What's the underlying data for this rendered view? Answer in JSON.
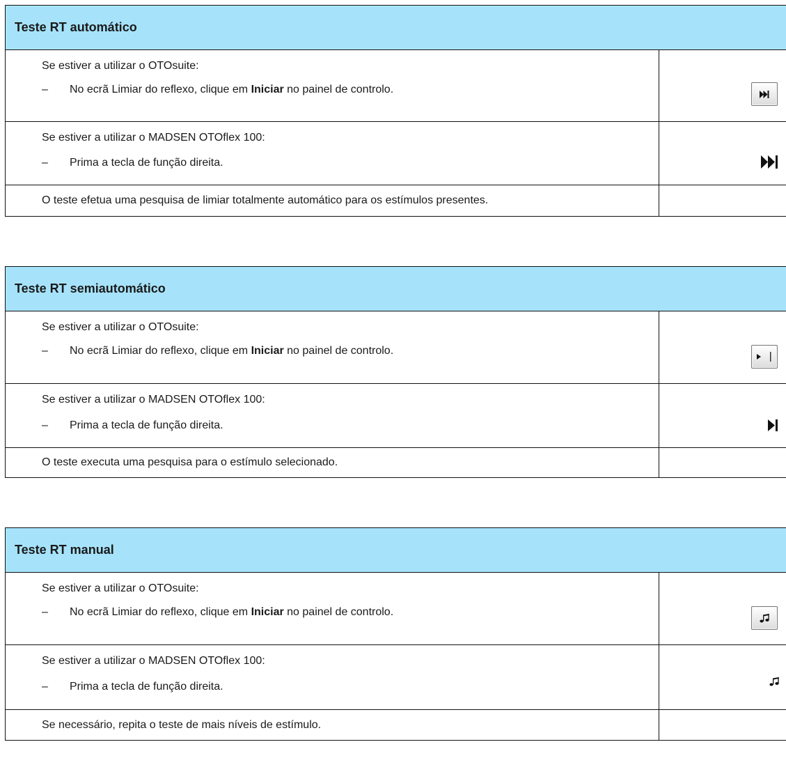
{
  "sections": [
    {
      "title": "Teste RT automático",
      "otosuite_intro": "Se estiver a utilizar o OTOsuite:",
      "otosuite_step_pre": "No ecrã Limiar do reflexo, clique em ",
      "otosuite_step_bold": "Iniciar",
      "otosuite_step_post": " no painel de controlo.",
      "otoflex_intro": "Se estiver a utilizar o MADSEN OTOflex 100:",
      "otoflex_step": "Prima a tecla de função direita.",
      "result": "O teste efetua uma pesquisa de limiar totalmente automático para os estímulos presentes.",
      "button_icon": "fast-forward-end-icon",
      "key_icon": "fast-forward-end-icon"
    },
    {
      "title": "Teste RT semiautomático",
      "otosuite_intro": "Se estiver a utilizar o OTOsuite:",
      "otosuite_step_pre": "No ecrã Limiar do reflexo, clique em ",
      "otosuite_step_bold": "Iniciar",
      "otosuite_step_post": " no painel de controlo.",
      "otoflex_intro": "Se estiver a utilizar o MADSEN OTOflex 100:",
      "otoflex_step": "Prima a tecla de função direita.",
      "result": "O teste executa uma pesquisa para o estímulo selecionado.",
      "button_icon": "play-stop-icon",
      "key_icon": "play-end-icon"
    },
    {
      "title": "Teste RT manual",
      "otosuite_intro": "Se estiver a utilizar o OTOsuite:",
      "otosuite_step_pre": "No ecrã Limiar do reflexo, clique em ",
      "otosuite_step_bold": "Iniciar",
      "otosuite_step_post": " no painel de controlo.",
      "otoflex_intro": "Se estiver a utilizar o MADSEN OTOflex 100:",
      "otoflex_step": "Prima a tecla de função direita.",
      "result": "Se necessário, repita o teste de mais níveis de estímulo.",
      "button_icon": "music-note-icon",
      "key_icon": "music-note-icon"
    }
  ],
  "bullet_dash": "–"
}
